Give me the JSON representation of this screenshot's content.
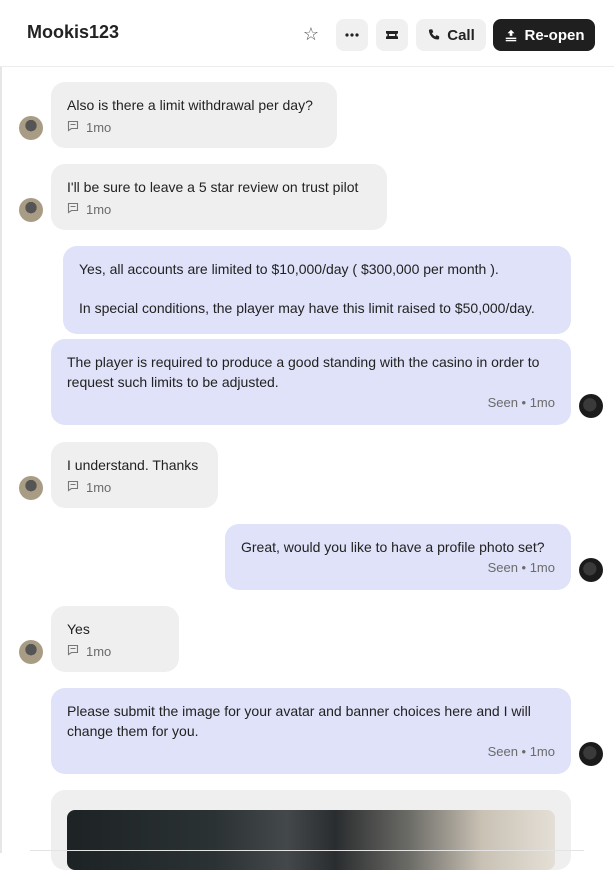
{
  "header": {
    "title": "Mookis123",
    "star_icon": "star-icon",
    "more_icon": "more-horizontal-icon",
    "ticket_icon": "ticket-icon",
    "call_label": "Call",
    "reopen_label": "Re-open"
  },
  "messages": [
    {
      "direction": "in",
      "text": "Also is there a limit withdrawal per day?",
      "time": "1mo"
    },
    {
      "direction": "in",
      "text": "I'll be sure to leave a 5 star review on trust pilot",
      "time": "1mo"
    },
    {
      "direction": "out",
      "text1": "Yes, all accounts are limited to $10,000/day ( $300,000 per month ).",
      "text2": "In special conditions, the player may have this limit raised to $50,000/day."
    },
    {
      "direction": "out",
      "text": "The player is required to produce a good standing with the casino in order to request such limits to be adjusted.",
      "status": "Seen • 1mo"
    },
    {
      "direction": "in",
      "text": "I understand. Thanks",
      "time": "1mo"
    },
    {
      "direction": "out",
      "text": "Great, would you like to have a profile photo set?",
      "status": "Seen • 1mo"
    },
    {
      "direction": "in",
      "text": "Yes",
      "time": "1mo"
    },
    {
      "direction": "out",
      "text": "Please submit the image for your avatar and banner choices here and I will change them for you.",
      "status": "Seen • 1mo"
    }
  ],
  "colors": {
    "incoming_bubble": "#efefef",
    "outgoing_bubble": "#dfe2f8",
    "reopen_button": "#1f1f1f"
  }
}
